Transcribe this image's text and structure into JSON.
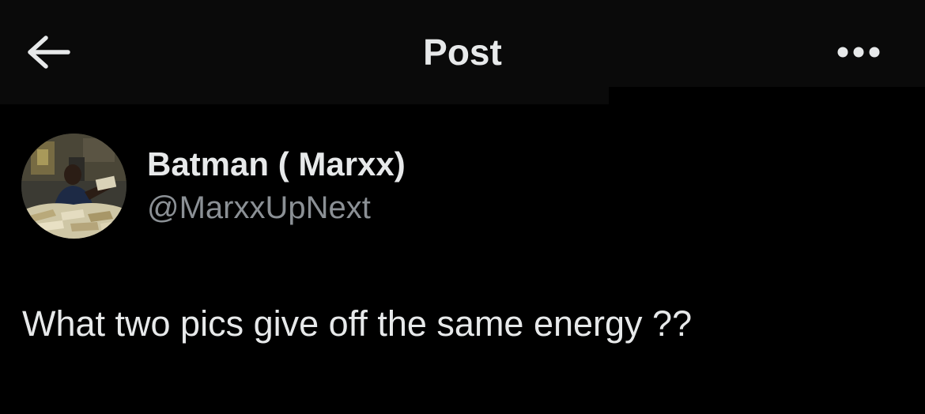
{
  "header": {
    "title": "Post",
    "back_icon": "arrow-left-icon",
    "more_icon": "more-horizontal-icon"
  },
  "post": {
    "author": {
      "display_name": "Batman ( Marxx)",
      "handle": "@MarxxUpNext",
      "avatar_icon": "avatar-photo"
    },
    "text": "What two pics give off the same energy ??"
  },
  "colors": {
    "background": "#000000",
    "header_background": "#0a0a0a",
    "primary_text": "#e7e9ea",
    "secondary_text": "#8b9095"
  }
}
